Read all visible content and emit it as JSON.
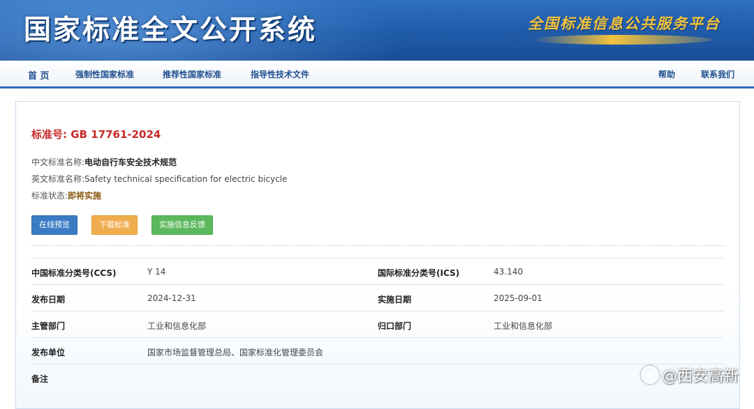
{
  "header": {
    "title": "国家标准全文公开系统",
    "slogan": "全国标准信息公共服务平台"
  },
  "nav": {
    "home": "首 页",
    "mandatory": "强制性国家标准",
    "recommended": "推荐性国家标准",
    "guidance": "指导性技术文件",
    "help": "帮助",
    "contact": "联系我们"
  },
  "standard": {
    "number_label": "标准号:",
    "number": "GB 17761-2024",
    "cn_name_label": "中文标准名称:",
    "cn_name": "电动自行车安全技术规范",
    "en_name_label": "英文标准名称:",
    "en_name": "Safety technical specification for electric bicycle",
    "status_label": "标准状态:",
    "status": "即将实施"
  },
  "buttons": {
    "preview": "在线预览",
    "download": "下载标准",
    "feedback": "实施信息反馈"
  },
  "details": {
    "ccs_label": "中国标准分类号(CCS)",
    "ccs": "Y 14",
    "ics_label": "国际标准分类号(ICS)",
    "ics": "43.140",
    "publish_date_label": "发布日期",
    "publish_date": "2024-12-31",
    "implement_date_label": "实施日期",
    "implement_date": "2025-09-01",
    "authority_label": "主管部门",
    "authority": "工业和信息化部",
    "centralized_label": "归口部门",
    "centralized": "工业和信息化部",
    "publisher_label": "发布单位",
    "publisher": "国家市场监督管理总局、国家标准化管理委员会",
    "remarks_label": "备注",
    "remarks": ""
  },
  "watermark": {
    "text": "@西安高新"
  },
  "colors": {
    "banner": "#1f5aa8",
    "nav_text": "#1f4f8f",
    "std_number": "#c62828",
    "btn_preview": "#3a7cc4",
    "btn_download": "#f0ad4e",
    "btn_feedback": "#5cb85c"
  }
}
